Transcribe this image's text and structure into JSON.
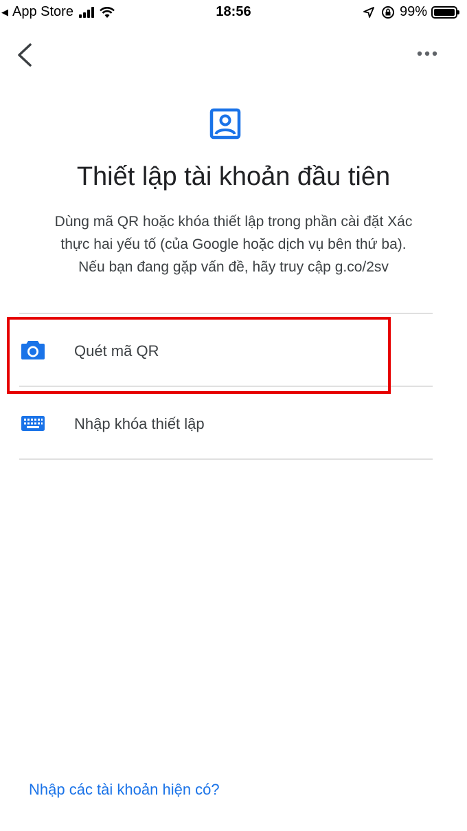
{
  "status_bar": {
    "back_app": "App Store",
    "time": "18:56",
    "battery": "99%",
    "battery_level": 0.99
  },
  "nav": {
    "back_icon": "chevron-left-icon",
    "more_icon": "more-horizontal-icon"
  },
  "header": {
    "icon": "account-box-icon",
    "title": "Thiết lập tài khoản đầu tiên",
    "description_lines": [
      "Dùng mã QR hoặc khóa thiết lập trong phần cài đặt Xác",
      "thực hai yếu tố (của Google hoặc dịch vụ bên thứ ba).",
      "Nếu bạn đang gặp vấn đề, hãy truy cập g.co/2sv"
    ]
  },
  "options": [
    {
      "label": "Quét mã QR",
      "icon": "camera-icon",
      "highlighted": true
    },
    {
      "label": "Nhập khóa thiết lập",
      "icon": "keyboard-icon",
      "highlighted": false
    }
  ],
  "footer": {
    "import_link": "Nhập các tài khoản hiện có?"
  },
  "colors": {
    "accent": "#1a73e8",
    "highlight": "#e60000",
    "divider": "#e0e0e0",
    "text": "#202124"
  }
}
